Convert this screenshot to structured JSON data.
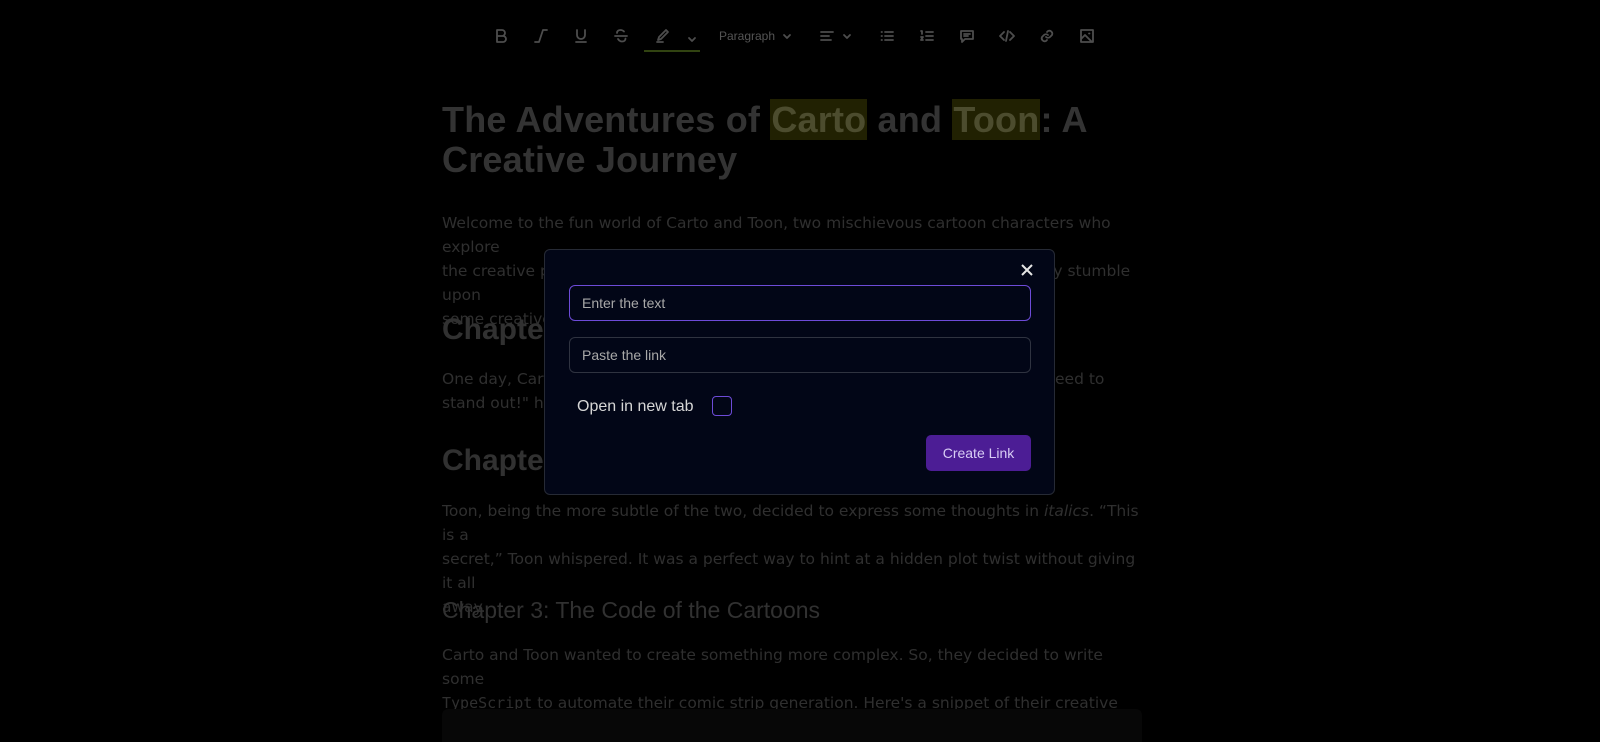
{
  "toolbar": {
    "icons": [
      "bold-icon",
      "italic-icon",
      "underline-icon",
      "strikethrough-icon",
      "highlighter-icon",
      "align-left-icon",
      "bullet-list-icon",
      "ordered-list-icon",
      "comment-icon",
      "code-icon",
      "link-icon",
      "image-icon"
    ],
    "paragraph_label": "Paragraph"
  },
  "document": {
    "title_before": "The Adventures of ",
    "title_hl1": "Carto",
    "title_mid": " and ",
    "title_hl2": "Toon",
    "title_after": ": A Creative Journey",
    "intro_line1": "Welcome to the fun world of Carto and Toon, two mischievous cartoon characters who explore",
    "intro_line2": "the creative possibilities of the Tiptap Editor. Let's see what happens when they stumble upon",
    "intro_line3": "some creative",
    "chapter1_heading": "Chapte",
    "chapter1_line1_start": "One day, Carto",
    "chapter1_line1_end": "eed to",
    "chapter1_line2": "stand out!\" he",
    "chapter2_heading": "Chapte",
    "chapter2_text_part1": "Toon, being the more subtle of the two, decided to express some thoughts in ",
    "chapter2_text_italic": "italics",
    "chapter2_text_part2": ". “This is a",
    "chapter2_line2": "secret,” Toon whispered. It was a perfect way to hint at a hidden plot twist without giving it all",
    "chapter2_line3": "away.",
    "chapter3_heading": "Chapter 3: The Code of the Cartoons",
    "chapter3_line1": "Carto and Toon wanted to create something more complex. So, they decided to write some",
    "chapter3_code": "TypeScript",
    "chapter3_line2_rest": " to automate their comic strip generation. Here's a snippet of their creative code:"
  },
  "modal": {
    "text_placeholder": "Enter the text",
    "link_placeholder": "Paste the link",
    "new_tab_label": "Open in new tab",
    "new_tab_checked": false,
    "create_label": "Create Link"
  },
  "colors": {
    "accent": "#6d4bd8",
    "button_bg": "#4c1d95",
    "highlight": "#3d3d05"
  }
}
